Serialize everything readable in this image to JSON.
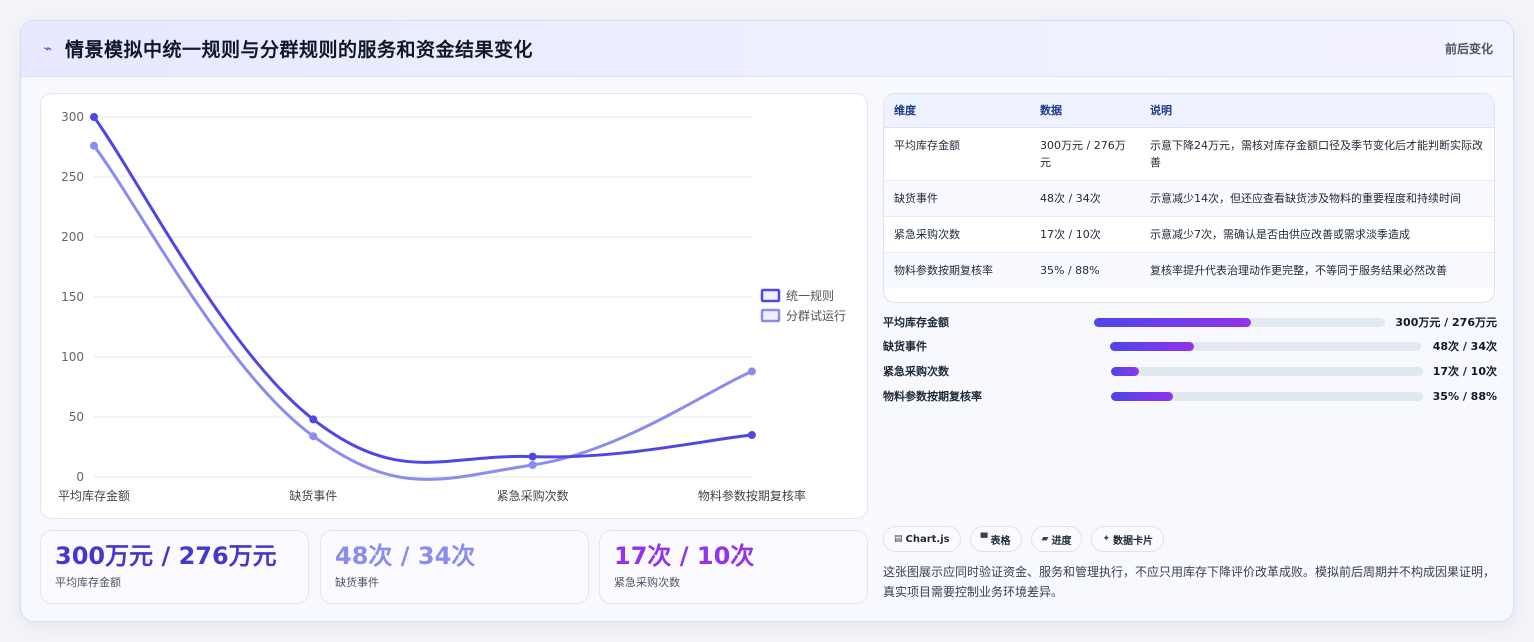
{
  "header": {
    "title": "情景模拟中统一规则与分群规则的服务和资金结果变化",
    "badge": "前后变化",
    "icon": "trend-icon"
  },
  "chart_data": {
    "type": "line",
    "categories": [
      "平均库存金额",
      "缺货事件",
      "紧急采购次数",
      "物料参数按期复核率"
    ],
    "series": [
      {
        "name": "统一规则",
        "values": [
          300,
          48,
          17,
          35
        ],
        "color": "#4f46e5"
      },
      {
        "name": "分群试运行",
        "values": [
          276,
          34,
          10,
          88
        ],
        "color": "#8b8cf0"
      }
    ],
    "ylim": [
      0,
      300
    ],
    "yticks": [
      "0",
      "50",
      "100",
      "150",
      "200",
      "250",
      "300"
    ],
    "grid": true,
    "legend_position": "right"
  },
  "stats": [
    {
      "value": "300万元 / 276万元",
      "label": "平均库存金额",
      "color": "#4338ca"
    },
    {
      "value": "48次 / 34次",
      "label": "缺货事件",
      "color": "#8b8cf0"
    },
    {
      "value": "17次 / 10次",
      "label": "紧急采购次数",
      "color": "#9333ea"
    }
  ],
  "table": {
    "headers": [
      "维度",
      "数据",
      "说明"
    ],
    "rows": [
      [
        "平均库存金额",
        "300万元 / 276万元",
        "示意下降24万元，需核对库存金额口径及季节变化后才能判断实际改善"
      ],
      [
        "缺货事件",
        "48次 / 34次",
        "示意减少14次，但还应查看缺货涉及物料的重要程度和持续时间"
      ],
      [
        "紧急采购次数",
        "17次 / 10次",
        "示意减少7次，需确认是否由供应改善或需求淡季造成"
      ],
      [
        "物料参数按期复核率",
        "35% / 88%",
        "复核率提升代表治理动作更完整，不等同于服务结果必然改善"
      ]
    ]
  },
  "bars": [
    {
      "label": "平均库存金额",
      "value": "300万元 / 276万元",
      "fraction": 0.54
    },
    {
      "label": "缺货事件",
      "value": "48次 / 34次",
      "fraction": 0.27
    },
    {
      "label": "紧急采购次数",
      "value": "17次 / 10次",
      "fraction": 0.09
    },
    {
      "label": "物料参数按期复核率",
      "value": "35% / 88%",
      "fraction": 0.2
    }
  ],
  "chips": [
    {
      "icon": "chart-icon",
      "glyph": "▤",
      "label": "Chart.js"
    },
    {
      "icon": "table-icon",
      "glyph": "▀",
      "label": "表格"
    },
    {
      "icon": "progress-icon",
      "glyph": "▰",
      "label": "进度"
    },
    {
      "icon": "card-icon",
      "glyph": "✦",
      "label": "数据卡片"
    }
  ],
  "description": "这张图展示应同时验证资金、服务和管理执行，不应只用库存下降评价改革成败。模拟前后周期并不构成因果证明，真实项目需要控制业务环境差异。"
}
